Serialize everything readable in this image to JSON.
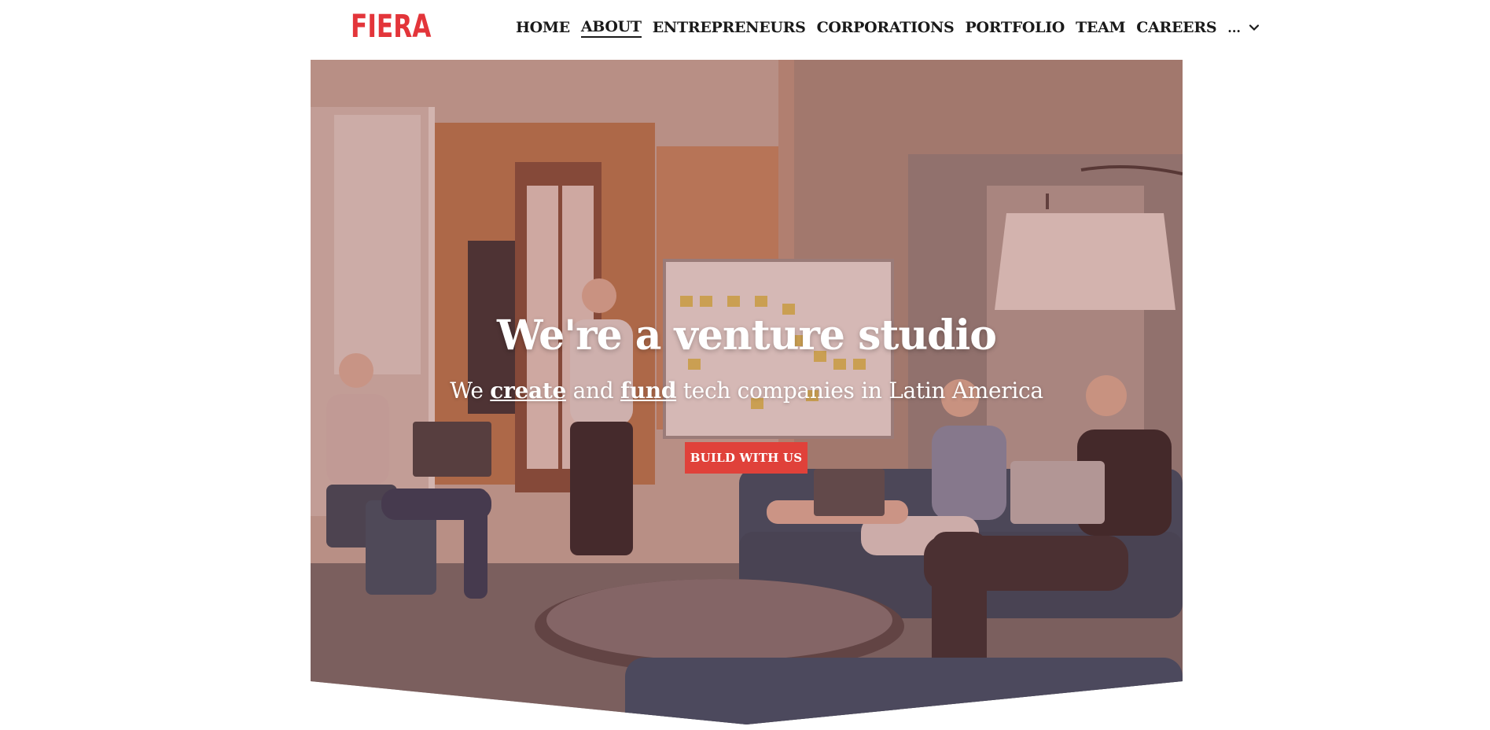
{
  "brand": {
    "logo_text": "FIERA",
    "color": "#e3353a"
  },
  "nav": {
    "items": [
      {
        "label": "HOME",
        "active": false
      },
      {
        "label": "ABOUT",
        "active": true
      },
      {
        "label": "ENTREPRENEURS",
        "active": false
      },
      {
        "label": "CORPORATIONS",
        "active": false
      },
      {
        "label": "PORTFOLIO",
        "active": false
      },
      {
        "label": "TEAM",
        "active": false
      },
      {
        "label": "CAREERS",
        "active": false
      }
    ],
    "more_label": "...",
    "more_icon": "chevron-down-icon"
  },
  "hero": {
    "title": "We're a venture studio",
    "subtitle": {
      "prefix": "We",
      "link1": "create",
      "middle": "and",
      "link2": "fund",
      "suffix": "tech companies in Latin America"
    },
    "cta_label": "BUILD WITH US",
    "cta_color": "#e0413a"
  }
}
